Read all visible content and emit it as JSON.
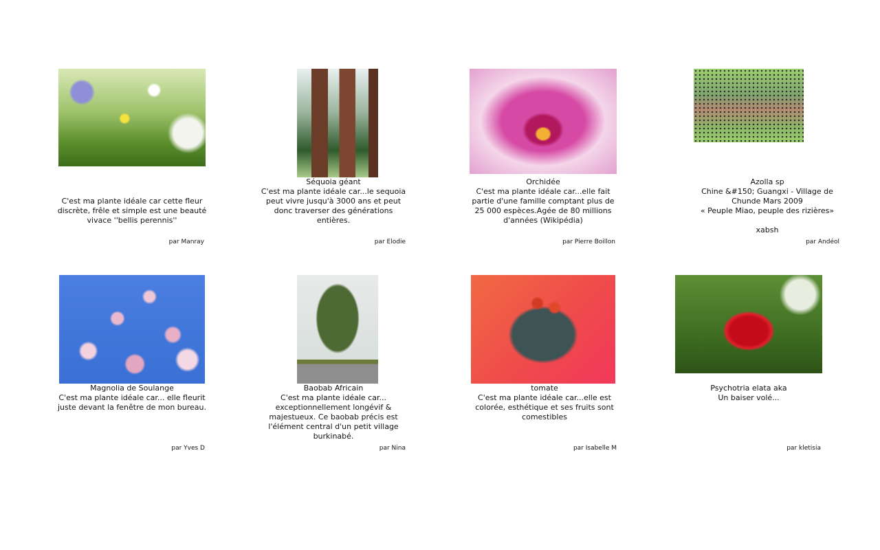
{
  "gallery": {
    "items": [
      {
        "photo_icon": "daisy-photo",
        "caption": "\n\nC'est ma plante idéale car cette fleur\ndiscrète, frêle et simple est une beauté\nvivace ''bellis perennis''",
        "author": "par Manray"
      },
      {
        "photo_icon": "sequoia-photo",
        "caption": "Séquoia géant\nC'est ma plante idéale car...le sequoia\npeut vivre jusqu'à 3000 ans et peut\ndonc traverser des générations\nentières.",
        "author": "par Elodie"
      },
      {
        "photo_icon": "orchid-photo",
        "caption": "Orchidée\nC'est ma plante idéale car...elle fait\npartie d'une famille comptant plus de\n25 000 espèces.Agée de 80 millions\nd'années (Wikipédia)",
        "author": "par Pierre Boillon"
      },
      {
        "photo_icon": "azolla-photo",
        "caption": "Azolla sp\nChine &#150; Guangxi - Village de\nChunde Mars 2009\n« Peuple Miao, peuple des rizières»\n\nxabsh",
        "author": "par Andéol"
      },
      {
        "photo_icon": "magnolia-photo",
        "caption": "Magnolia de Soulange\nC'est ma plante idéale car... elle fleurit\njuste devant la fenêtre de mon bureau.",
        "author": "par Yves D"
      },
      {
        "photo_icon": "baobab-photo",
        "caption": "Baobab Africain\nC'est ma plante idéale car...\nexceptionnellement longévif &\nmajestueux. Ce baobab précis est\nl'élément central d'un petit village\nburkinabé.",
        "author": "par Nina"
      },
      {
        "photo_icon": "tomato-photo",
        "caption": "tomate\nC'est ma plante idéale car...elle est\ncolorée, esthétique et ses fruits sont\ncomestibles",
        "author": "par Isabelle M"
      },
      {
        "photo_icon": "lips-plant-photo",
        "caption": "\nPsychotria elata aka\nUn baiser volé...",
        "author": "par kletisia"
      }
    ]
  }
}
